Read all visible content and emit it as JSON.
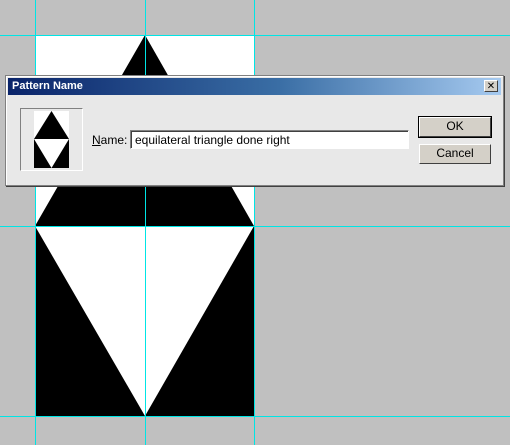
{
  "dialog": {
    "title": "Pattern Name",
    "close_glyph": "✕",
    "name_label_accel": "N",
    "name_label_rest": "ame:",
    "name_value": "equilateral triangle done right",
    "ok_label": "OK",
    "cancel_label": "Cancel"
  },
  "colors": {
    "guide": "#00e5e5",
    "workspace": "#c0c0c0",
    "title_gradient_start": "#0a246a",
    "title_gradient_end": "#a6caf0"
  }
}
